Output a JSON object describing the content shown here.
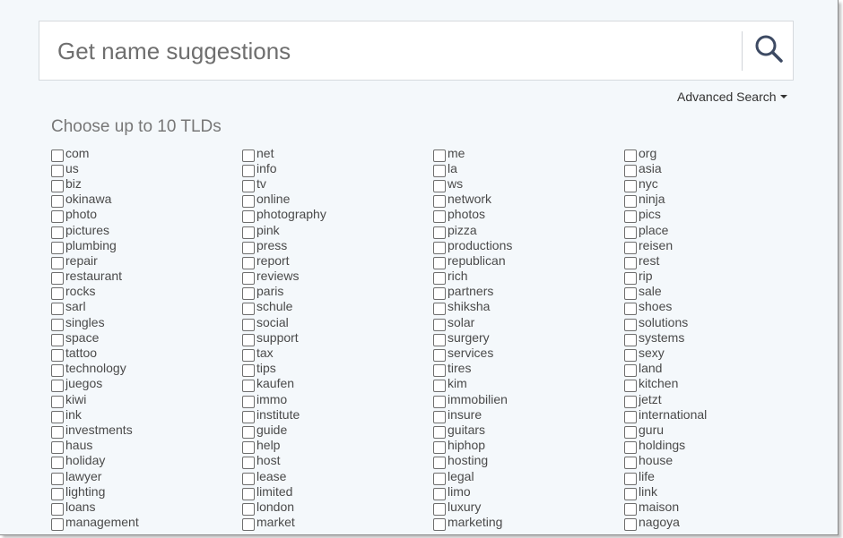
{
  "search": {
    "placeholder": "Get name suggestions",
    "icon": "search-icon"
  },
  "advanced_search": {
    "label": "Advanced Search"
  },
  "tld_heading": "Choose up to 10 TLDs",
  "colors": {
    "page_bg": "#f4f8fb",
    "input_bg": "#ffffff",
    "icon": "#3d4a63"
  },
  "tlds": [
    "com",
    "net",
    "me",
    "org",
    "us",
    "info",
    "la",
    "asia",
    "biz",
    "tv",
    "ws",
    "nyc",
    "okinawa",
    "online",
    "network",
    "ninja",
    "photo",
    "photography",
    "photos",
    "pics",
    "pictures",
    "pink",
    "pizza",
    "place",
    "plumbing",
    "press",
    "productions",
    "reisen",
    "repair",
    "report",
    "republican",
    "rest",
    "restaurant",
    "reviews",
    "rich",
    "rip",
    "rocks",
    "paris",
    "partners",
    "sale",
    "sarl",
    "schule",
    "shiksha",
    "shoes",
    "singles",
    "social",
    "solar",
    "solutions",
    "space",
    "support",
    "surgery",
    "systems",
    "tattoo",
    "tax",
    "services",
    "sexy",
    "technology",
    "tips",
    "tires",
    "land",
    "juegos",
    "kaufen",
    "kim",
    "kitchen",
    "kiwi",
    "immo",
    "immobilien",
    "jetzt",
    "ink",
    "institute",
    "insure",
    "international",
    "investments",
    "guide",
    "guitars",
    "guru",
    "haus",
    "help",
    "hiphop",
    "holdings",
    "holiday",
    "host",
    "hosting",
    "house",
    "lawyer",
    "lease",
    "legal",
    "life",
    "lighting",
    "limited",
    "limo",
    "link",
    "loans",
    "london",
    "luxury",
    "maison",
    "management",
    "market",
    "marketing",
    "nagoya"
  ]
}
